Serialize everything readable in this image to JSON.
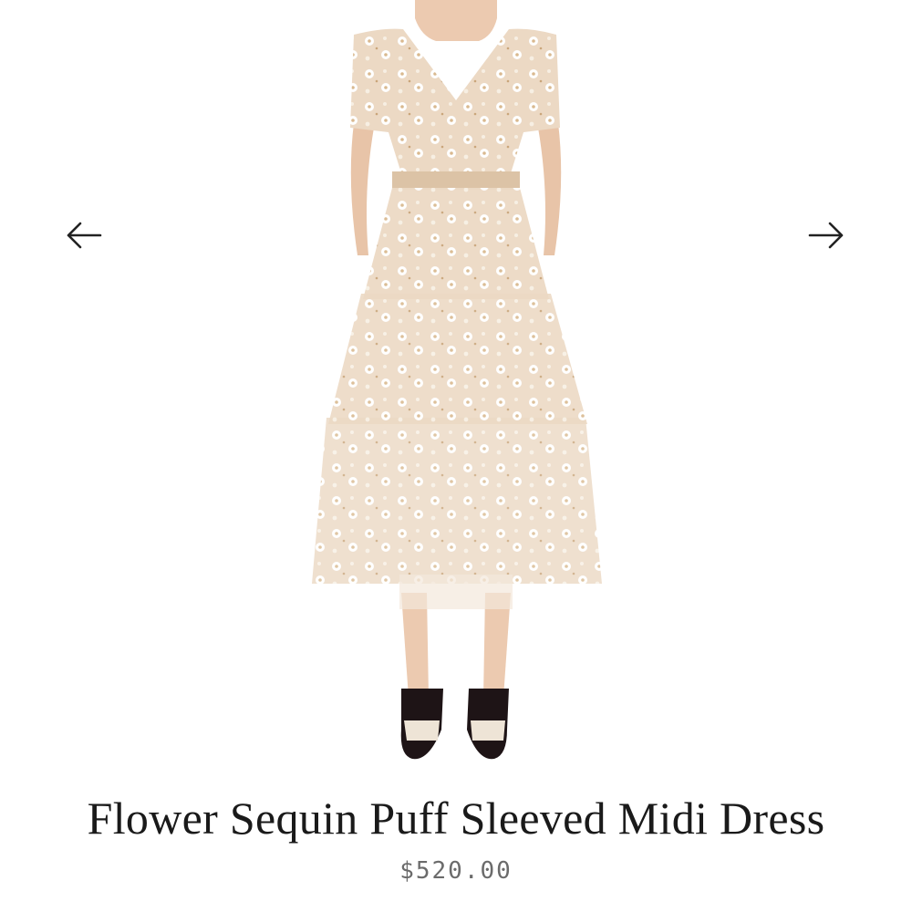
{
  "product": {
    "title": "Flower Sequin Puff Sleeved Midi Dress",
    "price": "$520.00"
  },
  "gallery": {
    "prev_icon": "arrow-left-icon",
    "next_icon": "arrow-right-icon"
  },
  "colors": {
    "dress": "#ecd9c4",
    "skin": "#eccab0",
    "shoe": "#1e1416",
    "text": "#1a1a1a",
    "price": "#6b6b6b"
  }
}
